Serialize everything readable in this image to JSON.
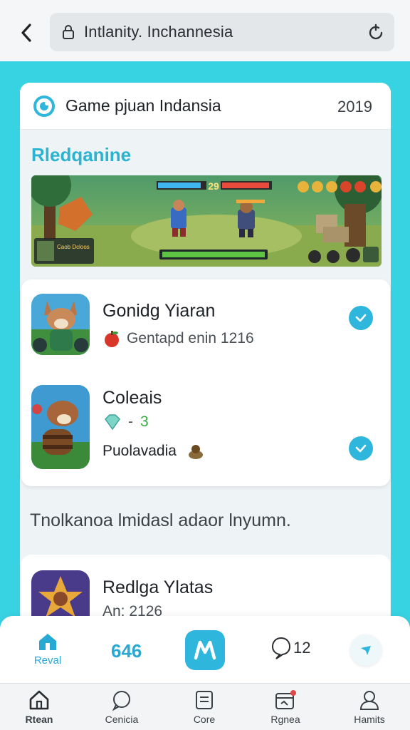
{
  "browser": {
    "url": "Intlanity. Inchannesia"
  },
  "header": {
    "title": "Game pjuan Indansia",
    "year": "2019"
  },
  "section_title": "Rledqanine",
  "banner": {
    "score": "29",
    "hud_label": "Caob Dcloos"
  },
  "apps": [
    {
      "title": "Gonidg Yiaran",
      "subtitle": "Gentapd enin 1216"
    },
    {
      "title": "Coleais",
      "rating_value": "3",
      "extra": "Puolavadia"
    }
  ],
  "section2_title": "Tnolkanoa lmidasl  adaor lnyumn.",
  "app3": {
    "title": "Redlga Ylatas",
    "subtitle": "An: 2126"
  },
  "action_bar": {
    "reveal_label": "Reval",
    "count_label": "646",
    "chat_label": "12"
  },
  "tabs": [
    {
      "label": "Rtean",
      "icon": "home-icon"
    },
    {
      "label": "Cenicia",
      "icon": "chat-icon"
    },
    {
      "label": "Core",
      "icon": "document-icon"
    },
    {
      "label": "Rgnea",
      "icon": "calendar-icon"
    },
    {
      "label": "Hamits",
      "icon": "profile-icon"
    }
  ],
  "colors": {
    "accent": "#2fb6dc",
    "background": "#38d3e3",
    "brand_title": "#2bb3cf"
  }
}
